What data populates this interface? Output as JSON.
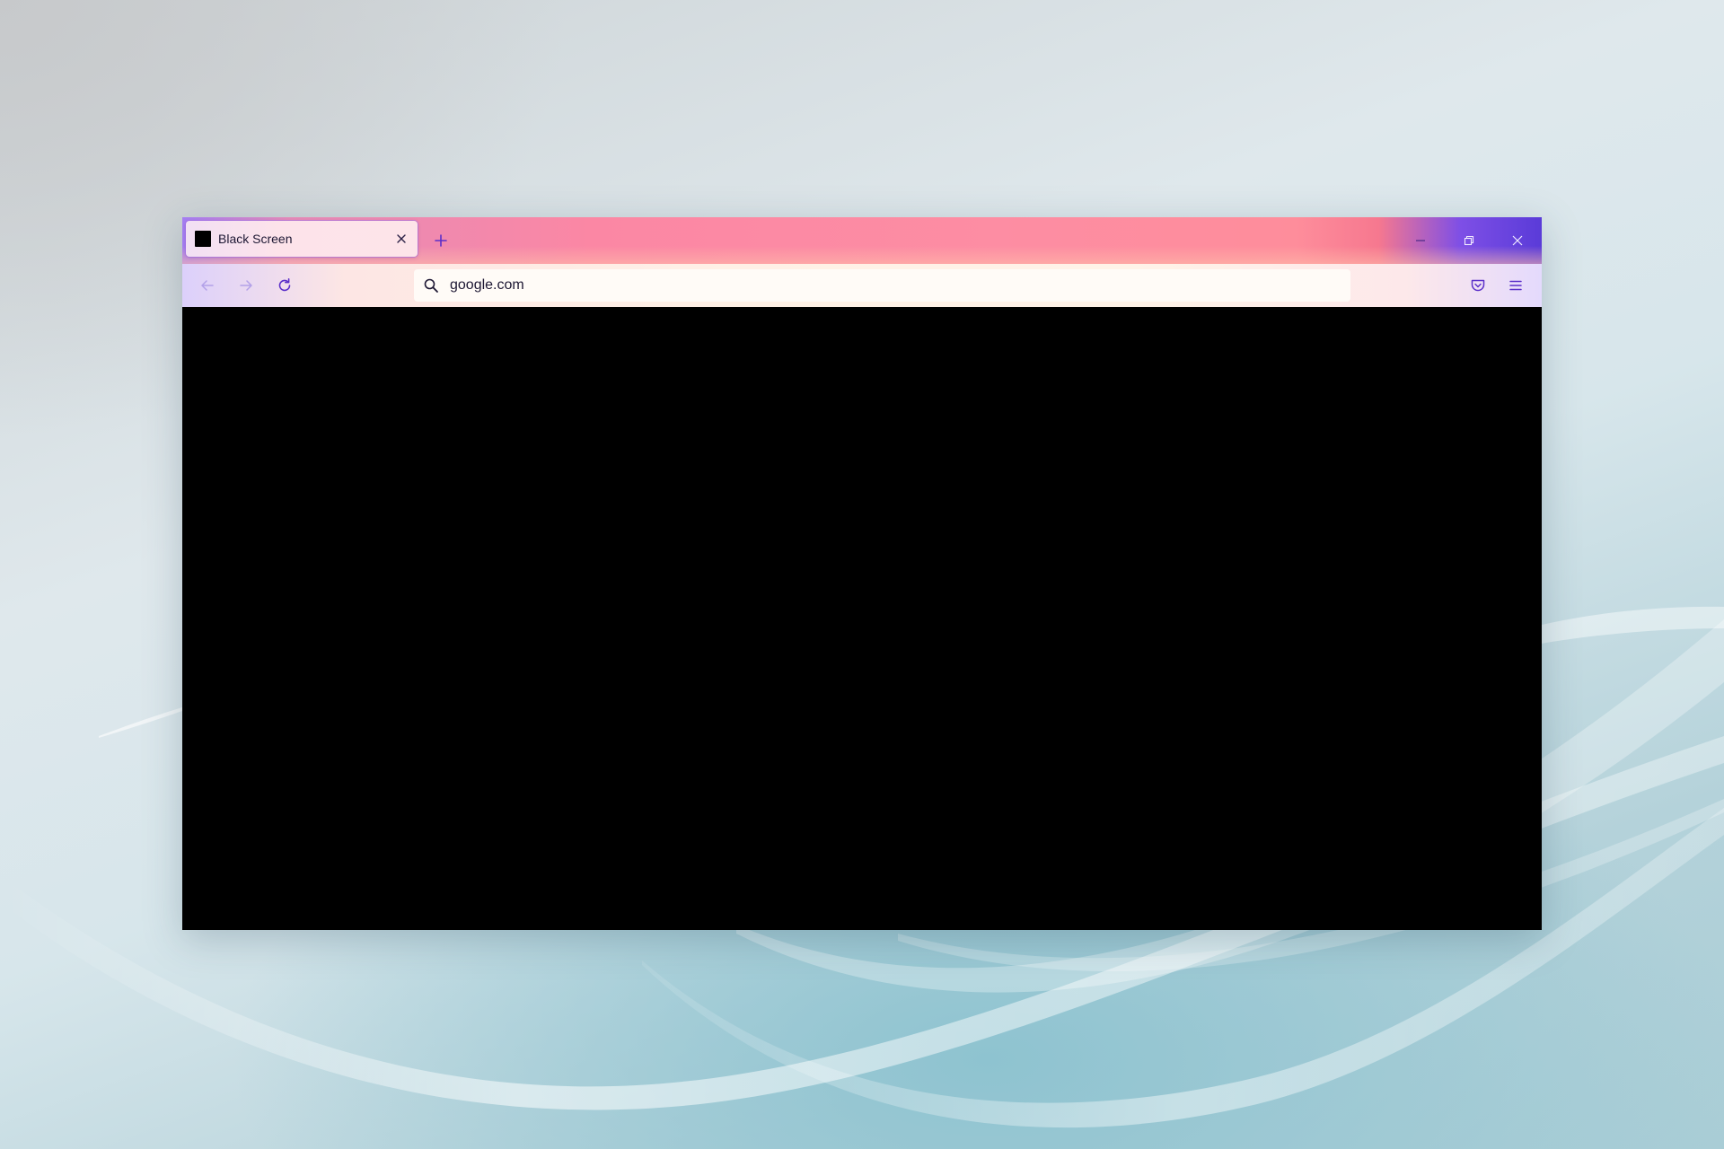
{
  "browser": {
    "tab": {
      "title": "Black Screen",
      "favicon": "black-square-icon"
    },
    "toolbar": {
      "address": "google.com",
      "icons": [
        "back-arrow-icon",
        "forward-arrow-icon",
        "reload-icon",
        "search-icon",
        "pocket-icon",
        "hamburger-menu-icon"
      ]
    },
    "window_controls": [
      "minimize-icon",
      "restore-icon",
      "close-icon"
    ],
    "content": {
      "background": "#000000"
    }
  },
  "colors": {
    "accent": "#5b2fc9",
    "titlebar_pink": "#fd8da3",
    "titlebar_purple": "#5a3bd8",
    "toolbar_cream": "#fff3e8"
  }
}
